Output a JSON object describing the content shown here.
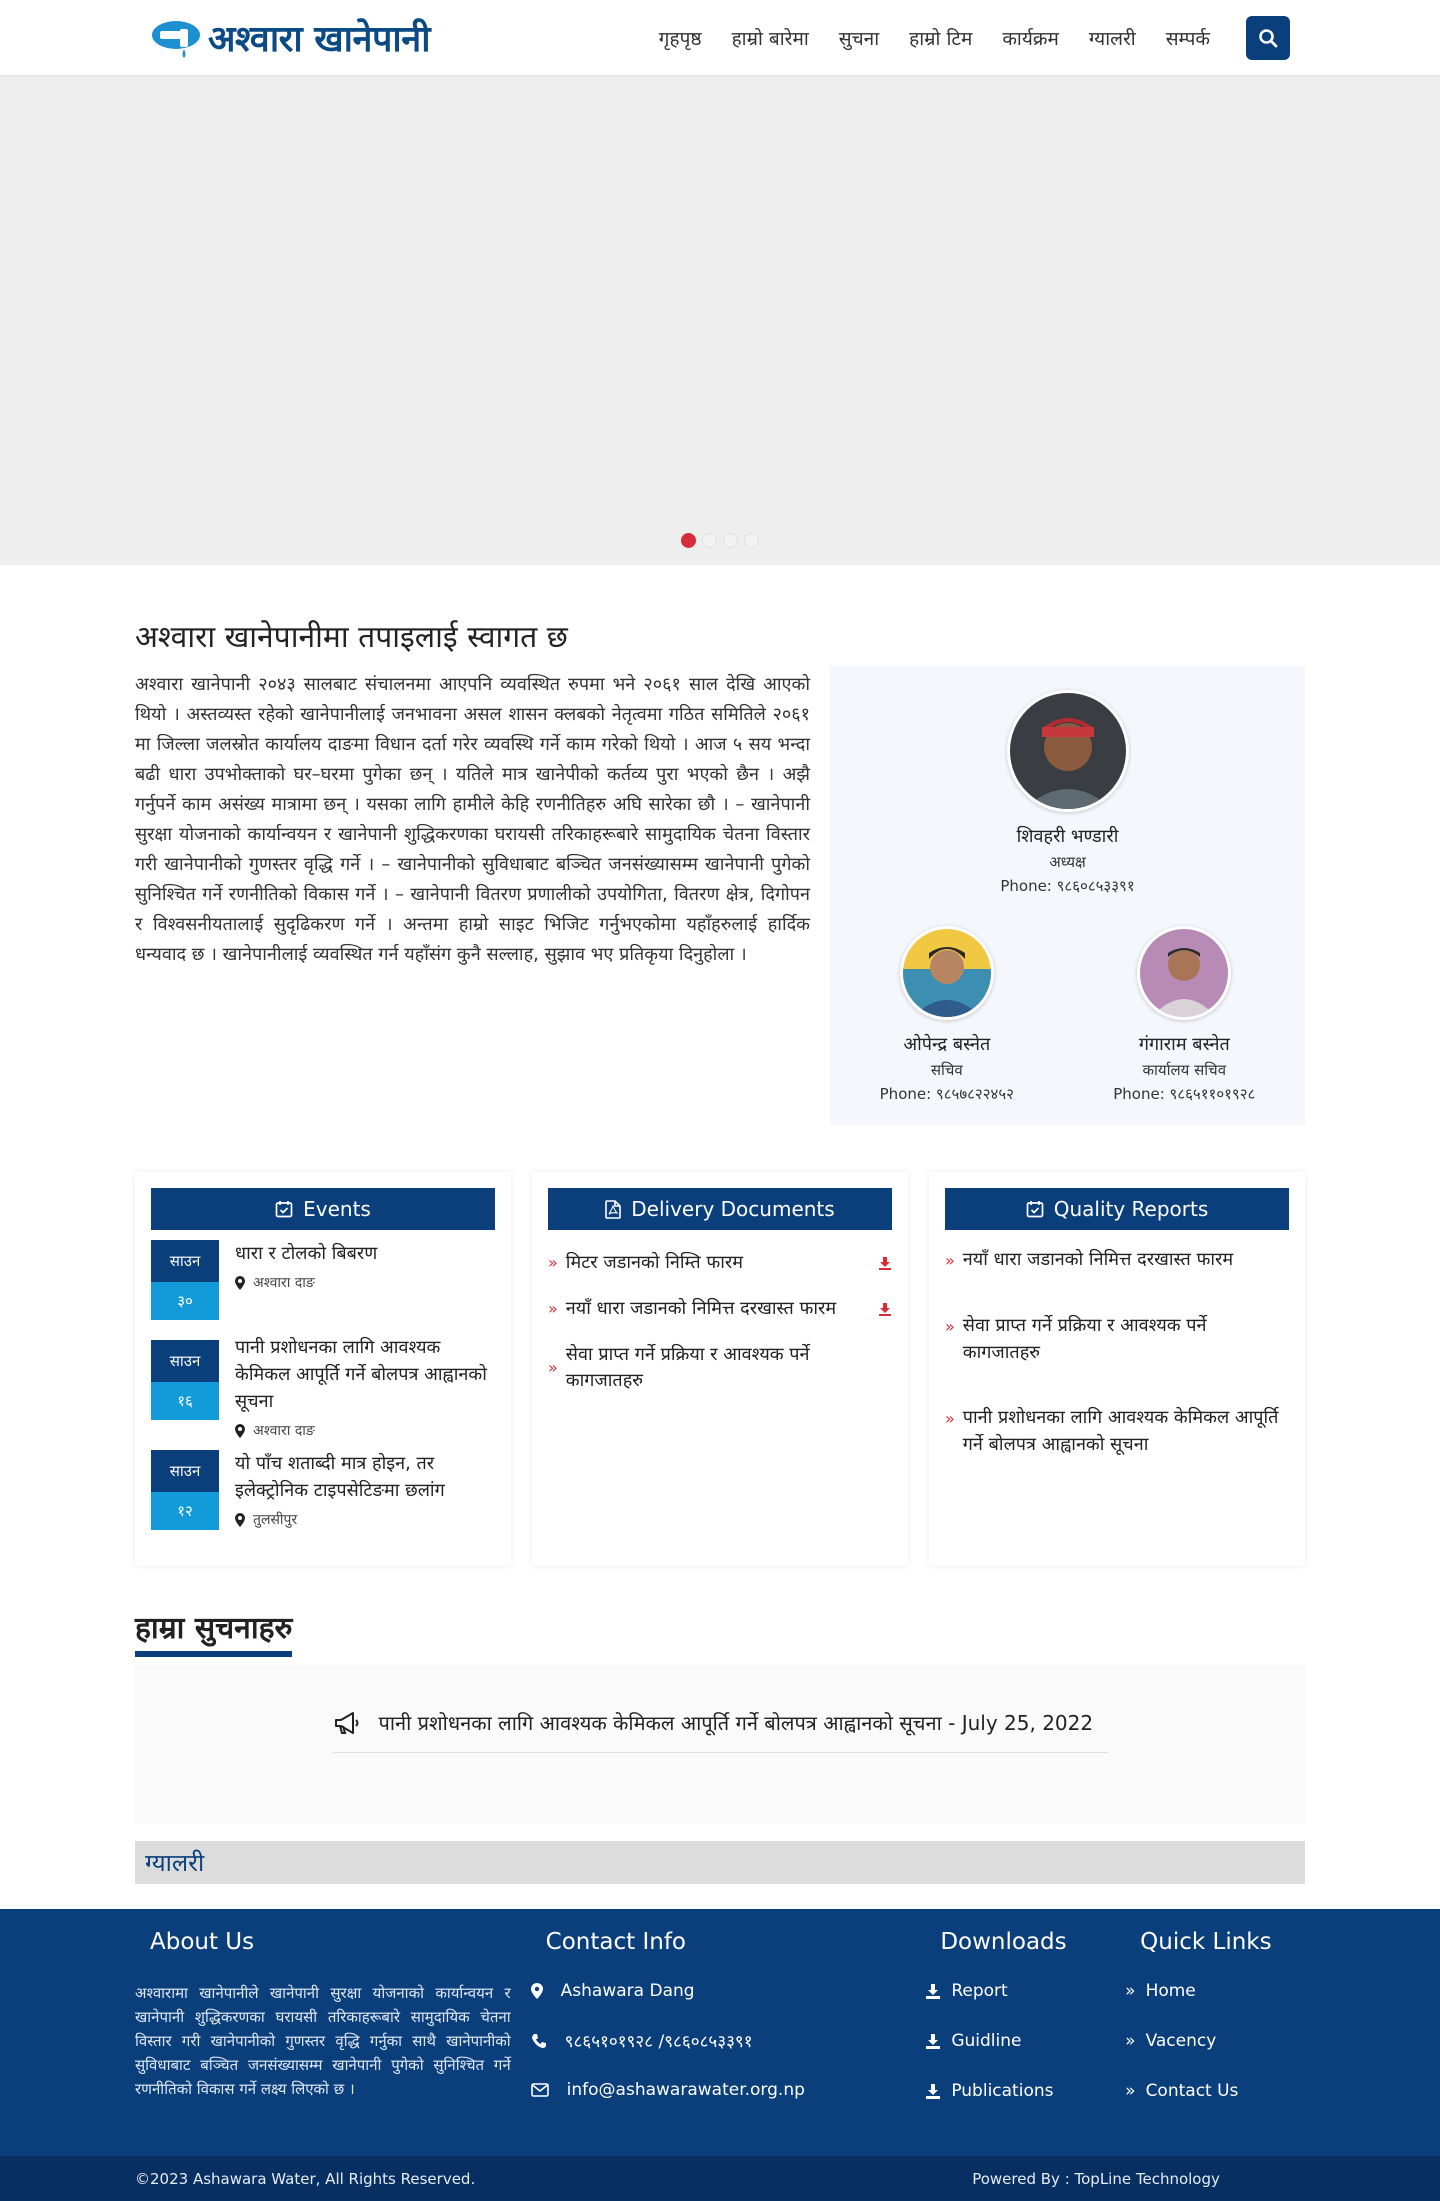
{
  "brand": {
    "logo_text": "अश्वारा खानेपानी",
    "primary_color": "#0b3f7c",
    "accent_color": "#d62d3a"
  },
  "nav": {
    "items": [
      "गृहपृष्ठ",
      "हाम्रो बारेमा",
      "सुचना",
      "हाम्रो टिम",
      "कार्यक्रम",
      "ग्यालरी",
      "सम्पर्क"
    ],
    "search_icon": "search-icon"
  },
  "hero": {
    "slides": 4,
    "active_slide": 1
  },
  "welcome": {
    "title": "अश्वारा खानेपानीमा तपाइलाई स्वागत छ",
    "text": "अश्वारा खानेपानी २०४३ सालबाट संचालनमा आएपनि व्यवस्थित रुपमा भने २०६१ साल देखि आएको थियो । अस्तव्यस्त रहेको खानेपानीलाई जनभावना असल शासन क्लबको नेतृत्वमा गठित समितिले २०६१ मा जिल्ला जलस्रोत कार्यालय दाङमा विधान दर्ता गरेर व्यवस्थि गर्ने काम गरेको थियो । आज ५ सय भन्दा बढी धारा उपभोक्ताको घर–घरमा पुगेका छन् । यतिले मात्र खानेपीको कर्तव्य पुरा भएको छैन । अझै गर्नुपर्ने काम असंख्य मात्रामा छन् । यसका लागि हामीले केहि रणनीतिहरु अघि सारेका छौ । – खानेपानी सुरक्षा योजनाको कार्यान्वयन र खानेपानी शुद्धिकरणका घरायसी तरिकाहरूबारे सामुदायिक चेतना विस्तार गरी खानेपानीको गुणस्तर वृद्धि गर्ने । – खानेपानीको सुविधाबाट बञ्चित जनसंख्यासम्म खानेपानी पुगेको सुनिश्चित गर्ने रणनीतिको विकास गर्ने । – खानेपानी वितरण प्रणालीको उपयोगिता, वितरण क्षेत्र, दिगोपन र विश्वसनीयतालाई सुदृढिकरण गर्ने । अन्तमा हाम्रो साइट भिजिट गर्नुभएकोमा यहाँहरुलाई हार्दिक धन्यवाद छ । खानेपानीलाई व्यवस्थित गर्न यहाँसंग कुनै सल्लाह, सुझाव भए प्रतिकृया दिनुहोला ।"
  },
  "team": [
    {
      "name": "शिवहरी भण्डारी",
      "role": "अध्यक्ष",
      "phone": "Phone: ९८६०८५३३९१"
    },
    {
      "name": "ओपेन्द्र बस्नेत",
      "role": "सचिव",
      "phone": "Phone: ९८५७८२२४५२"
    },
    {
      "name": "गंगाराम बस्नेत",
      "role": "कार्यालय सचिव",
      "phone": "Phone: ९८६५११०१९२८"
    }
  ],
  "events": {
    "title": "Events",
    "items": [
      {
        "month": "साउन",
        "day": "३०",
        "title": "धारा र टोलको बिबरण",
        "location": "अश्वारा दाङ"
      },
      {
        "month": "साउन",
        "day": "१६",
        "title": "पानी प्रशोधनका लागि आवश्यक केमिकल आपूर्ति गर्ने बोलपत्र आह्वानको सूचना",
        "location": "अश्वारा दाङ"
      },
      {
        "month": "साउन",
        "day": "१२",
        "title": "यो पाँच शताब्दी मात्र होइन, तर इलेक्ट्रोनिक टाइपसेटिङमा छलांग",
        "location": "तुलसीपुर"
      }
    ]
  },
  "delivery": {
    "title": "Delivery Documents",
    "items": [
      {
        "label": "मिटर जडानको निम्ति फारम",
        "download": true
      },
      {
        "label": "नयाँ धारा जडानको निमित्त दरखास्त फारम",
        "download": true
      },
      {
        "label": "सेवा प्राप्त गर्ने प्रक्रिया र आवश्यक पर्ने कागजातहरु",
        "download": false
      }
    ]
  },
  "quality": {
    "title": "Quality Reports",
    "items": [
      "नयाँ धारा जडानको निमित्त दरखास्त फारम",
      "सेवा प्राप्त गर्ने प्रक्रिया र आवश्यक पर्ने कागजातहरु",
      "पानी प्रशोधनका लागि आवश्यक केमिकल आपूर्ति गर्ने बोलपत्र आह्वानको सूचना"
    ]
  },
  "notices": {
    "title": "हाम्रा सुचनाहरु",
    "items": [
      "पानी प्रशोधनका लागि आवश्यक केमिकल आपूर्ति गर्ने बोलपत्र आह्वानको सूचना - July 25, 2022"
    ]
  },
  "gallery": {
    "title": "ग्यालरी"
  },
  "footer": {
    "about_title": "About Us",
    "about_text": "अश्वारामा खानेपानीले खानेपानी सुरक्षा योजनाको कार्यान्वयन र खानेपानी शुद्धिकरणका घरायसी तरिकाहरूबारे सामुदायिक चेतना विस्तार गरी खानेपानीको गुणस्तर वृद्धि गर्नुका साथै खानेपानीको सुविधाबाट बञ्चित जनसंख्यासम्म खानेपानी पुगेको सुनिश्चित गर्ने रणनीतिको विकास गर्ने लक्ष्य लिएको छ ।",
    "contact_title": "Contact Info",
    "address": "Ashawara Dang",
    "phone": "९८६५१०१९२८ /९८६०८५३३९१",
    "email": "info@ashawarawater.org.np",
    "downloads_title": "Downloads",
    "downloads": [
      "Report",
      "Guidline",
      "Publications"
    ],
    "quicklinks_title": "Quick Links",
    "quicklinks": [
      "Home",
      "Vacency",
      "Contact Us"
    ],
    "copyright": "©2023 Ashawara Water, All Rights Reserved.",
    "powered": "Powered By : TopLine Technology"
  }
}
